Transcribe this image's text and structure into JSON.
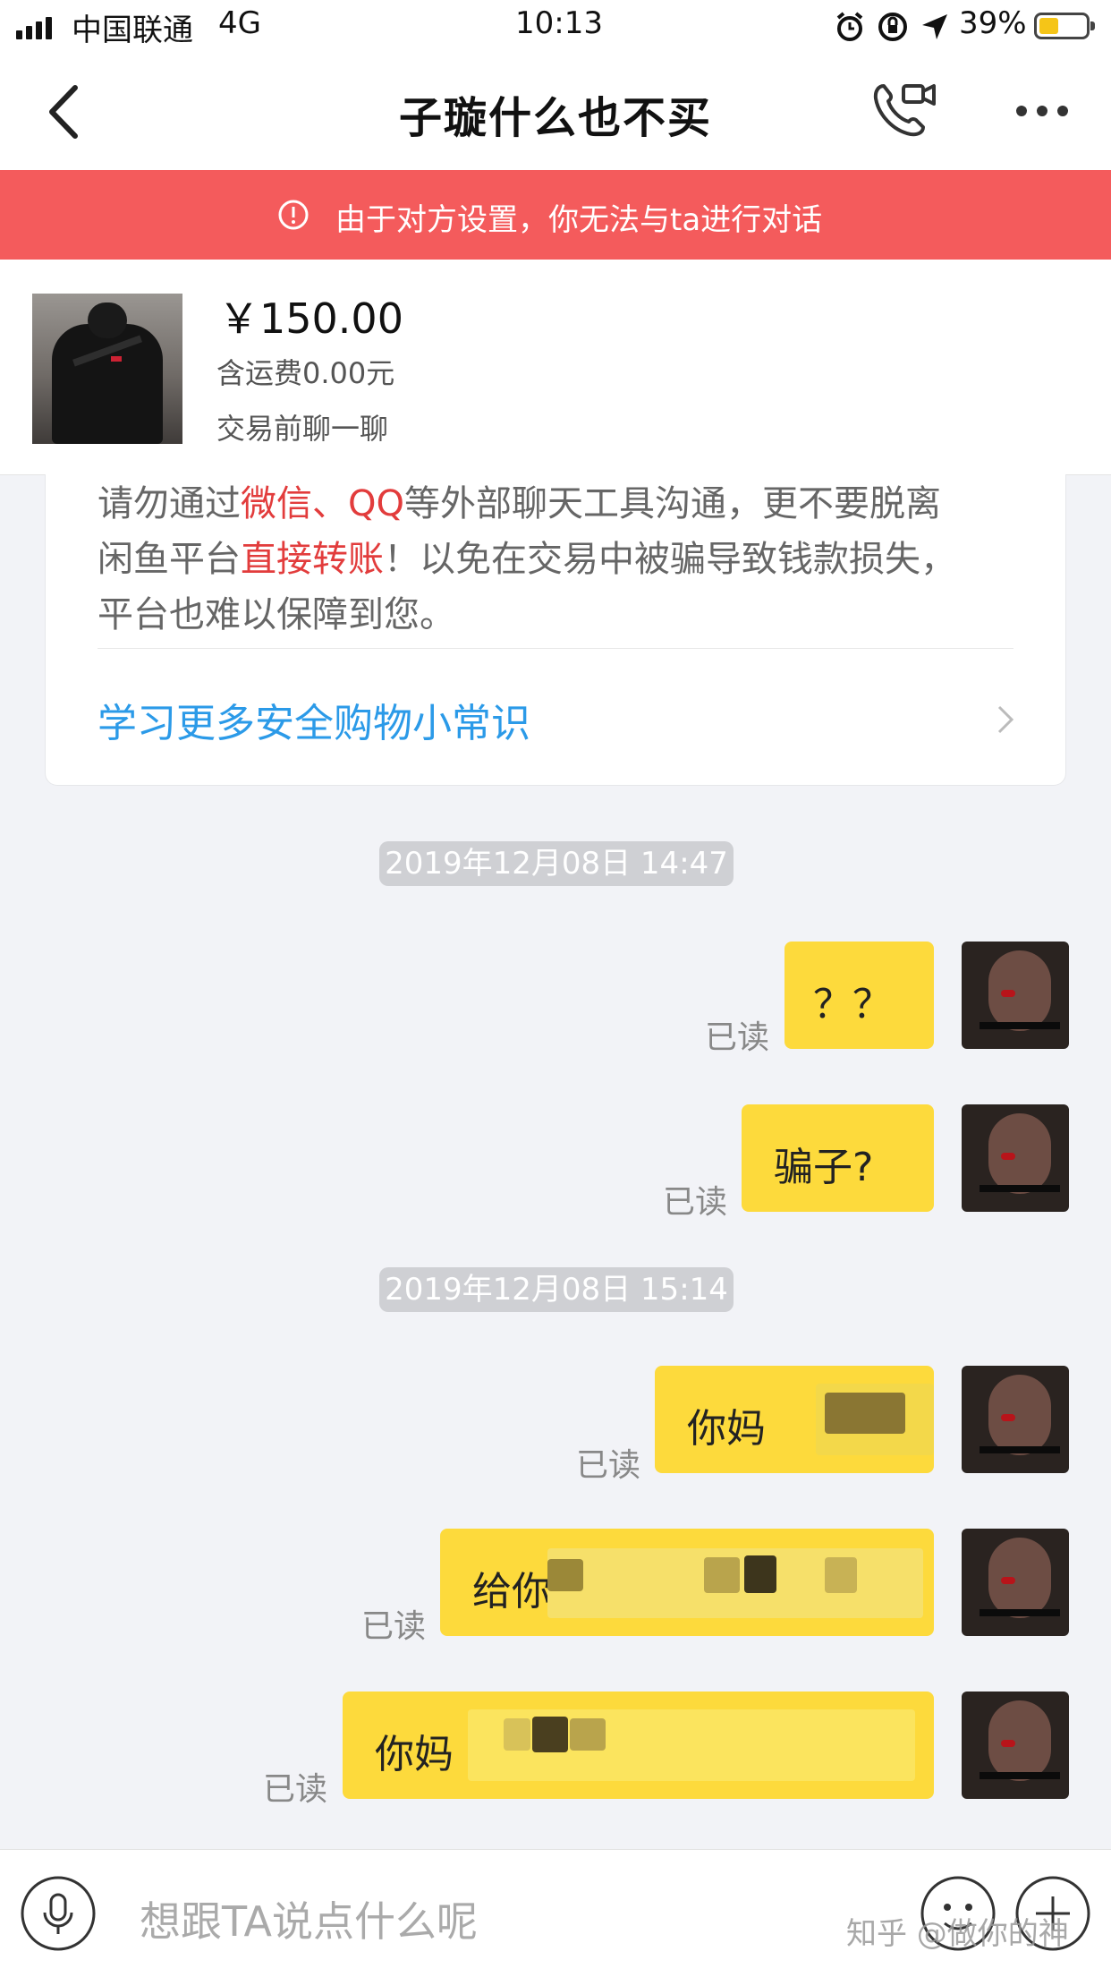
{
  "status_bar": {
    "carrier": "中国联通",
    "network": "4G",
    "time": "10:13",
    "battery": "39%",
    "icons": [
      "signal-icon",
      "alarm-icon",
      "orientation-lock-icon",
      "location-icon",
      "battery-icon"
    ]
  },
  "nav": {
    "title": "子璇什么也不买",
    "icons": [
      "back-icon",
      "video-call-icon",
      "more-icon"
    ]
  },
  "banner": {
    "text": "由于对方设置，你无法与ta进行对话",
    "icon": "info-icon"
  },
  "product": {
    "price": "￥150.00",
    "shipping": "含运费0.00元",
    "action": "交易前聊一聊"
  },
  "safety": {
    "line1_a": "请勿通过",
    "line1_red": "微信、QQ",
    "line1_b": "等外部聊天工具沟通，更不要脱离",
    "line2_a": "闲鱼平台",
    "line2_red": "直接转账",
    "line2_b": "！以免在交易中被骗导致钱款损失，",
    "line3": "平台也难以保障到您。",
    "link": "学习更多安全购物小常识",
    "link_icon": "chevron-right-icon"
  },
  "timestamps": [
    "2019年12月08日 14:47",
    "2019年12月08日 15:14"
  ],
  "messages": [
    {
      "text": "？？",
      "status": "已读"
    },
    {
      "text": "骗子?",
      "status": "已读"
    },
    {
      "text": "你妈",
      "status": "已读",
      "censored": true
    },
    {
      "text": "给你",
      "status": "已读",
      "censored": true
    },
    {
      "text": "你妈",
      "status": "已读",
      "censored": true
    }
  ],
  "input": {
    "placeholder": "想跟TA说点什么呢",
    "icons": [
      "microphone-icon",
      "emoji-icon",
      "plus-icon"
    ]
  },
  "watermark": "知乎 @做你的神",
  "colors": {
    "banner": "#f45b5c",
    "bubble": "#fdda3c",
    "link": "#2b9ae8",
    "warning_red": "#e23c3c",
    "timestamp_bg": "#cfd0d4"
  }
}
